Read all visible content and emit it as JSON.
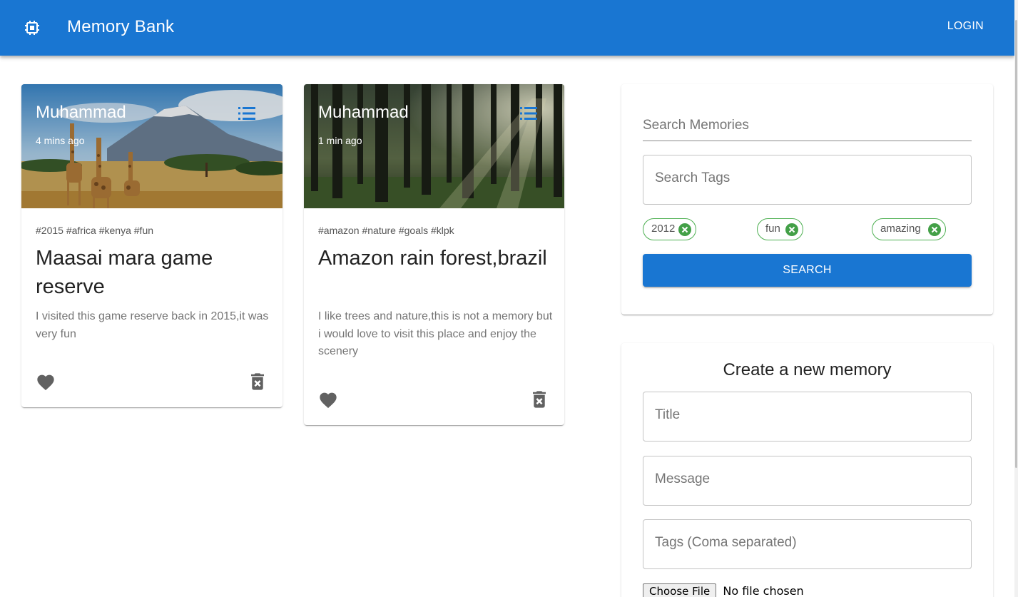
{
  "appbar": {
    "title": "Memory Bank",
    "login_label": "LOGIN",
    "logo_icon": "chip-icon",
    "color": "#1976d2"
  },
  "posts": [
    {
      "author": "Muhammad",
      "time": "4 mins ago",
      "tags": "#2015 #africa #kenya #fun",
      "title": "Maasai mara game reserve",
      "message": "I visited this game reserve back in 2015,it was very fun",
      "image": "savanna-giraffes-photo"
    },
    {
      "author": "Muhammad",
      "time": "1 min ago",
      "tags": "#amazon #nature #goals #klpk",
      "title": "Amazon rain forest,brazil",
      "message": "I like trees and nature,this is not a memory but i would love to visit this place and enjoy the scenery",
      "image": "forest-photo"
    }
  ],
  "search": {
    "memories_placeholder": "Search Memories",
    "tags_placeholder": "Search Tags",
    "chips": [
      "2012",
      "fun",
      "amazing"
    ],
    "chip_color": "#4caf50",
    "button_label": "SEARCH"
  },
  "create": {
    "heading": "Create a new memory",
    "title_placeholder": "Title",
    "message_placeholder": "Message",
    "tags_placeholder": "Tags (Coma separated)",
    "file_button": "Choose File",
    "file_status": "No file chosen"
  }
}
